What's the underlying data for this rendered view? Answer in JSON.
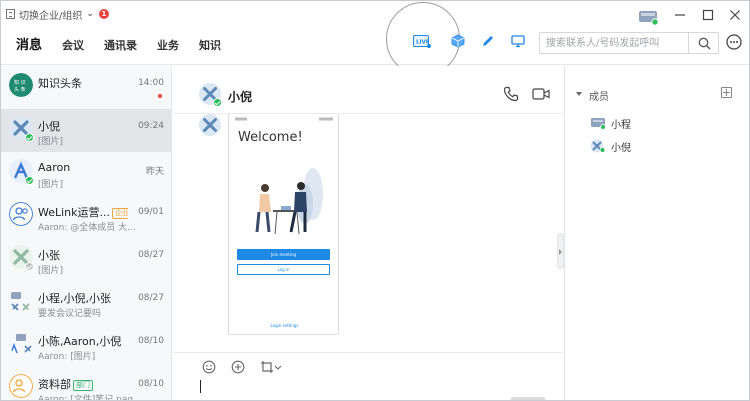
{
  "org": {
    "switch_label": "切换企业/组织",
    "badge": "1"
  },
  "nav": {
    "tabs": [
      "消息",
      "会议",
      "通讯录",
      "业务",
      "知识"
    ]
  },
  "search": {
    "placeholder": "搜索联系人/号码发起呼叫"
  },
  "conversations": [
    {
      "name": "知识头条",
      "snippet": "",
      "time": "14:00",
      "tag": "",
      "unread_dot": true
    },
    {
      "name": "小倪",
      "snippet": "[图片]",
      "time": "09:24",
      "tag": "",
      "unread_dot": false
    },
    {
      "name": "Aaron",
      "snippet": "[图片]",
      "time": "昨天",
      "tag": "",
      "unread_dot": false
    },
    {
      "name": "WeLink运营...",
      "snippet": "Aaron: @全体成员 大...",
      "time": "09/01",
      "tag": "企业",
      "unread_dot": false
    },
    {
      "name": "小张",
      "snippet": "[图片]",
      "time": "08/27",
      "tag": "",
      "unread_dot": false
    },
    {
      "name": "小程,小倪,小张",
      "snippet": "要发会议记要吗",
      "time": "08/27",
      "tag": "",
      "unread_dot": false
    },
    {
      "name": "小陈,Aaron,小倪",
      "snippet": "Aaron: [图片]",
      "time": "08/10",
      "tag": "",
      "unread_dot": false
    },
    {
      "name": "资料部",
      "snippet": "Aaron: [文件]笔记.pag...",
      "time": "08/10",
      "tag": "部门",
      "unread_dot": false
    }
  ],
  "chat": {
    "title": "小倪",
    "image_preview": {
      "welcome": "Welcome!",
      "join_button": "Join meeting",
      "login_button": "Log in",
      "settings_link": "Login settings"
    }
  },
  "members": {
    "label": "成员",
    "list": [
      "小程",
      "小倪"
    ]
  },
  "colors": {
    "accent": "#1e88e5",
    "badge_red": "#e8433d",
    "online_green": "#2ebd59"
  }
}
